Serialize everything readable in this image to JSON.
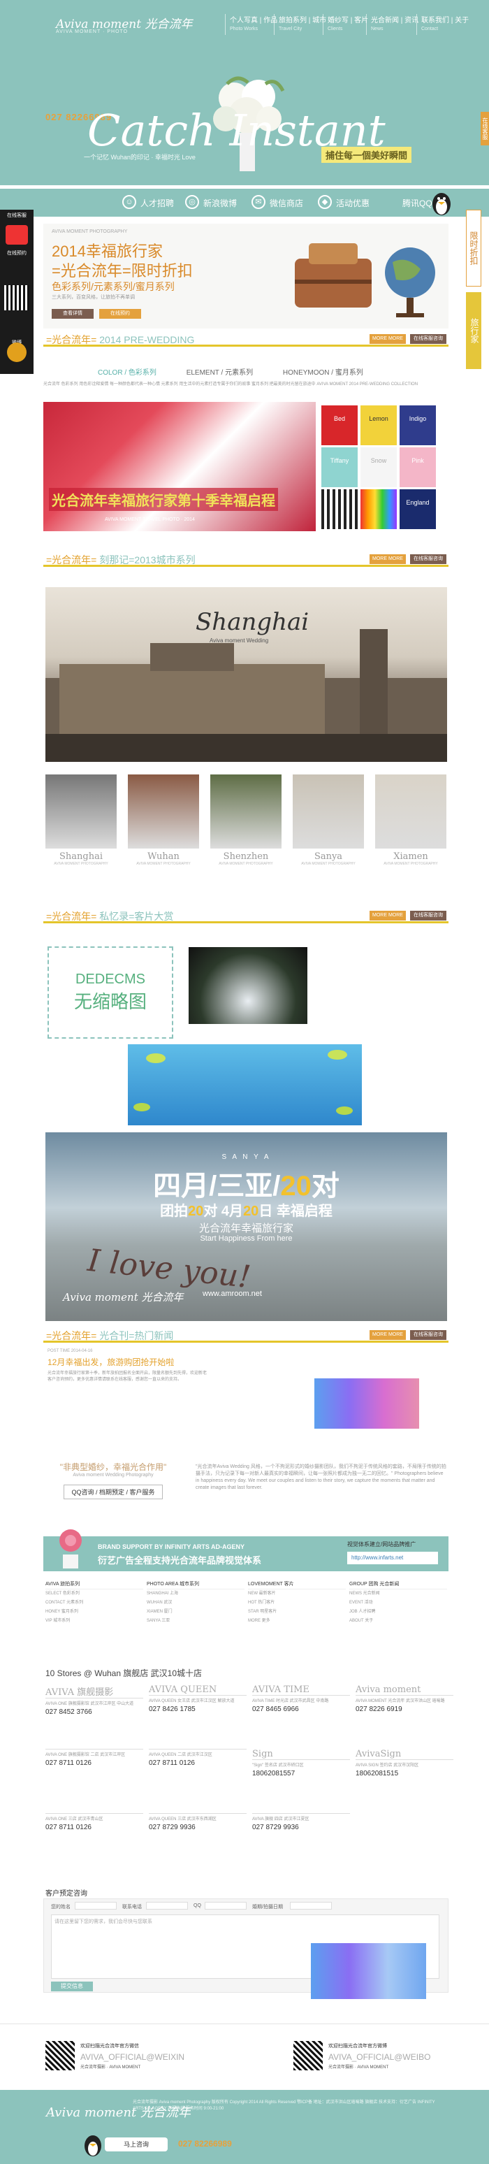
{
  "header": {
    "logo": "Aviva moment 光合流年",
    "logo_sub": "AVIVA MOMENT · PHOTO",
    "nav": [
      {
        "label": "个人写真 | 作品",
        "sub": "Photo Works"
      },
      {
        "label": "旅拍系列 | 城市",
        "sub": "Travel City"
      },
      {
        "label": "婚纱写 | 客片",
        "sub": "Clients"
      },
      {
        "label": "光合新闻 | 资讯",
        "sub": "News"
      },
      {
        "label": "联系我们 | 关于",
        "sub": "Contact"
      }
    ]
  },
  "hero": {
    "phone": "027 82266989",
    "title": "Catch Instant",
    "slogan": "一个记忆 Wuhan的印记 · 幸福时光 Love",
    "tag": "捕住每一個美好瞬間",
    "side_tab": "在线客服"
  },
  "menubar": [
    {
      "label": "人才招聘",
      "icon": "person-icon"
    },
    {
      "label": "新浪微博",
      "icon": "weibo-icon"
    },
    {
      "label": "微信商店",
      "icon": "wechat-icon"
    },
    {
      "label": "活动优惠",
      "icon": "tag-icon"
    },
    {
      "label": "腾讯QQ",
      "icon": "qq-icon"
    }
  ],
  "left_rail": [
    "在线客服",
    "在线预约",
    "官方微信",
    "微博"
  ],
  "right_rail": [
    "限时折扣",
    "旅行家"
  ],
  "promo": {
    "small": "AVIVA MOMENT PHOTOGRAPHY",
    "line1": "2014幸福旅行家",
    "line2": "=光合流年=限时折扣",
    "line3": "色彩系列/元素系列/蜜月系列",
    "desc": "三大系列，百变风格，让旅拍不再单调",
    "btn1": "查看详情",
    "btn2": "在线预约"
  },
  "section1": {
    "title_a": "=光合流年=",
    "title_b": "2014 PRE-WEDDING",
    "more": "MORE MORE",
    "book": "在线客服咨询"
  },
  "legend": [
    "COLOR / 色彩系列",
    "ELEMENT / 元素系列",
    "HONEYMOON / 蜜月系列"
  ],
  "tiny_desc": "光合流年 色彩系列 用色彩诠释爱情 每一种颜色都代表一种心情 元素系列 用生活中的元素打造专属于你们的故事 蜜月系列 把最美的时光留在旅途中 AVIVA MOMENT 2014 PRE-WEDDING COLLECTION",
  "umbrella": {
    "caption": "光合流年幸福旅行家第十季幸福启程",
    "sub": "AVIVA MOMENT TRAVEL PHOTO · 2014"
  },
  "swatches": [
    {
      "label": "Bed",
      "color": "#d8262a",
      "text": "#ffffff"
    },
    {
      "label": "Lemon",
      "color": "#f2d23a",
      "text": "#333333"
    },
    {
      "label": "Indigo",
      "color": "#2f3c8c",
      "text": "#ffffff"
    },
    {
      "label": "Tiffany",
      "color": "#8fd4d0",
      "text": "#ffffff"
    },
    {
      "label": "Snow",
      "color": "#f5f5f5",
      "text": "#aaaaaa"
    },
    {
      "label": "Pink",
      "color": "#f4b6c8",
      "text": "#ffffff"
    },
    {
      "label": "",
      "color": "#222222",
      "text": "#ffffff"
    },
    {
      "label": "",
      "color": "#c43a8a",
      "text": "#ffffff"
    },
    {
      "label": "England",
      "color": "#1a2b6d",
      "text": "#ffffff"
    }
  ],
  "section2": {
    "title_a": "=光合流年=",
    "title_b": "刻那记=2013城市系列",
    "more": "MORE MORE",
    "book": "在线客服咨询"
  },
  "city": {
    "title": "Shanghai",
    "sub": "Aviva moment Wedding"
  },
  "thumbs": [
    {
      "name": "Shanghai",
      "sub": "AVIVA MOMENT PHOTOGRAPHY",
      "color": "#777777"
    },
    {
      "name": "Wuhan",
      "sub": "AVIVA MOMENT PHOTOGRAPHY",
      "color": "#8a5a44"
    },
    {
      "name": "Shenzhen",
      "sub": "AVIVA MOMENT PHOTOGRAPHY",
      "color": "#5e6d45"
    },
    {
      "name": "Sanya",
      "sub": "AVIVA MOMENT PHOTOGRAPHY",
      "color": "#c9c2b5"
    },
    {
      "name": "Xiamen",
      "sub": "AVIVA MOMENT PHOTOGRAPHY",
      "color": "#d9d3c8"
    }
  ],
  "section3": {
    "title_a": "=光合流年=",
    "title_b": "私忆录=客片大赏",
    "more": "MORE MORE",
    "book": "在线客服咨询"
  },
  "dede": {
    "line1": "DEDECMS",
    "line2": "无缩略图"
  },
  "sanya": {
    "top": "S A N Y A",
    "line1a": "四月/三亚/",
    "line1b": "20",
    "line1c": "对",
    "line2a": "团拍",
    "line2b": "20",
    "line2c": "对 4月",
    "line2d": "20",
    "line2e": "日 幸福启程",
    "line3": "光合流年幸福旅行家",
    "line4": "Start Happiness From here",
    "sand": "I love you!",
    "brand": "Aviva moment 光合流年",
    "url": "www.amroom.net"
  },
  "section4": {
    "title_a": "=光合流年=",
    "title_b": "光合刊=热门新闻",
    "more": "MORE MORE",
    "book": "在线客服咨询"
  },
  "news": {
    "date": "POST TIME 2014-04-16",
    "headline": "12月幸福出发，旅游购团抢开始啦",
    "body": "光合流年幸福旅行家第十季，新年旅拍团报名全面开启，限量名额先到先得，欢迎新老客户咨询预约，更多优惠详情请联系在线客服，感谢您一直以来的支持。"
  },
  "love": {
    "a": "\"非典型婚纱，幸福光合作用\"",
    "b": "Aviva moment Wedding Photography",
    "c": "QQ咨询 / 档期预定 / 客户服务"
  },
  "love_desc": "\"光合流年Aviva Wedding 风格，一个不拘泥形式的婚纱摄影团队，我们不拘泥于传统风格的套路，不局限于传统的拍摄手法，只为记录下每一对新人最真实的幸福瞬间，让每一张照片都成为独一无二的回忆。\" Photographers believe in happiness every day. We meet our couples and listen to their story, we capture the moments that matter and create images that last forever.",
  "ad": {
    "a": "BRAND SUPPORT BY INFINITY ARTS AD-AGENY",
    "b": "衍艺广告全程支持光合流年品牌视觉体系",
    "c": "视觉体系建立/网站品牌推广",
    "d": "http://www.infarts.net"
  },
  "links": [
    {
      "head": "AVIVA 旅拍系列",
      "items": [
        "SELECT 色彩系列",
        "CONTACT 元素系列",
        "HONEY 蜜月系列",
        "VIP 城市系列"
      ]
    },
    {
      "head": "PHOTO AREA 城市系列",
      "items": [
        "SHANGHAI 上海",
        "WUHAN 武汉",
        "XIAMEN 厦门",
        "SANYA 三亚"
      ]
    },
    {
      "head": "LOVEMOMENT 客片",
      "items": [
        "NEW 最新客片",
        "HOT 热门客片",
        "STAR 明星客片",
        "MORE 更多"
      ]
    },
    {
      "head": "GROUP 团购 光合新闻",
      "items": [
        "NEWS 光合新闻",
        "EVENT 活动",
        "JOB 人才招聘",
        "ABOUT 关于"
      ]
    }
  ],
  "stores_title": "10 Stores @ Wuhan 旗舰店 武汉10城十店",
  "stores": [
    {
      "name": "AVIVA 旗舰摄影",
      "addr": "AVIVA ONE 旗舰摄影馆 武汉市江岸区 中山大道",
      "phone": "027 8452 3766"
    },
    {
      "name": "AVIVA QUEEN",
      "addr": "AVIVA QUEEN 女王店 武汉市江汉区 解放大道",
      "phone": "027 8426 1785"
    },
    {
      "name": "AVIVA TIME",
      "addr": "AVIVA TIME 时光店 武汉市武昌区 中南路",
      "phone": "027 8465 6966"
    },
    {
      "name": "Aviva moment",
      "addr": "AVIVA MOMENT 光合流年 武汉市洪山区 珞喻路",
      "phone": "027 8226 6919"
    },
    {
      "name": "",
      "addr": "AVIVA ONE 旗舰摄影馆 二店 武汉市江岸区",
      "phone": "027 8711 0126"
    },
    {
      "name": "",
      "addr": "AVIVA QUEEN 二店 武汉市江汉区",
      "phone": "027 8711 0126"
    },
    {
      "name": "Sign",
      "addr": "\"Sign\" 签名店 武汉市硚口区",
      "phone": "18062081557"
    },
    {
      "name": "AvivaSign",
      "addr": "AVIVA SIGN 签约店 武汉市汉阳区",
      "phone": "18062081515"
    },
    {
      "name": "",
      "addr": "AVIVA ONE 三店 武汉市青山区",
      "phone": "027 8711 0126"
    },
    {
      "name": "",
      "addr": "AVIVA QUEEN 三店 武汉市东西湖区",
      "phone": "027 8729 9936"
    },
    {
      "name": "",
      "addr": "AVIVA 旗舰 四店 武汉市江夏区",
      "phone": "027 8729 9936"
    }
  ],
  "form": {
    "title": "客户预定咨询",
    "labels": [
      "您的姓名",
      "联系电话",
      "QQ",
      "婚期/拍摄日期"
    ],
    "placeholder": "请在这里留下您的需求，我们会尽快与您联系",
    "submit": "提交信息"
  },
  "wechat": {
    "a": "欢迎扫描光合流年官方微信",
    "b": "AVIVA_OFFICIAL@WEIXIN",
    "c": "光合流年摄影 · AVIVA MOMENT"
  },
  "weibo": {
    "a": "欢迎扫描光合流年官方微博",
    "b": "AVIVA_OFFICIAL@WEIBO",
    "c": "光合流年摄影 · AVIVA MOMENT"
  },
  "footer": {
    "logo": "Aviva moment 光合流年",
    "info": "光合流年摄影 Aviva moment Photography 版权所有 Copyright 2014 All Rights Reserved 鄂ICP备 地址：武汉市洪山区珞喻路 旗舰店 技术支持：衍艺广告 INFINITY ARTS AD-AGENY 客服热线 服务时间 9:00-21:00",
    "qq": "马上咨询",
    "phone": "027 82266989"
  }
}
